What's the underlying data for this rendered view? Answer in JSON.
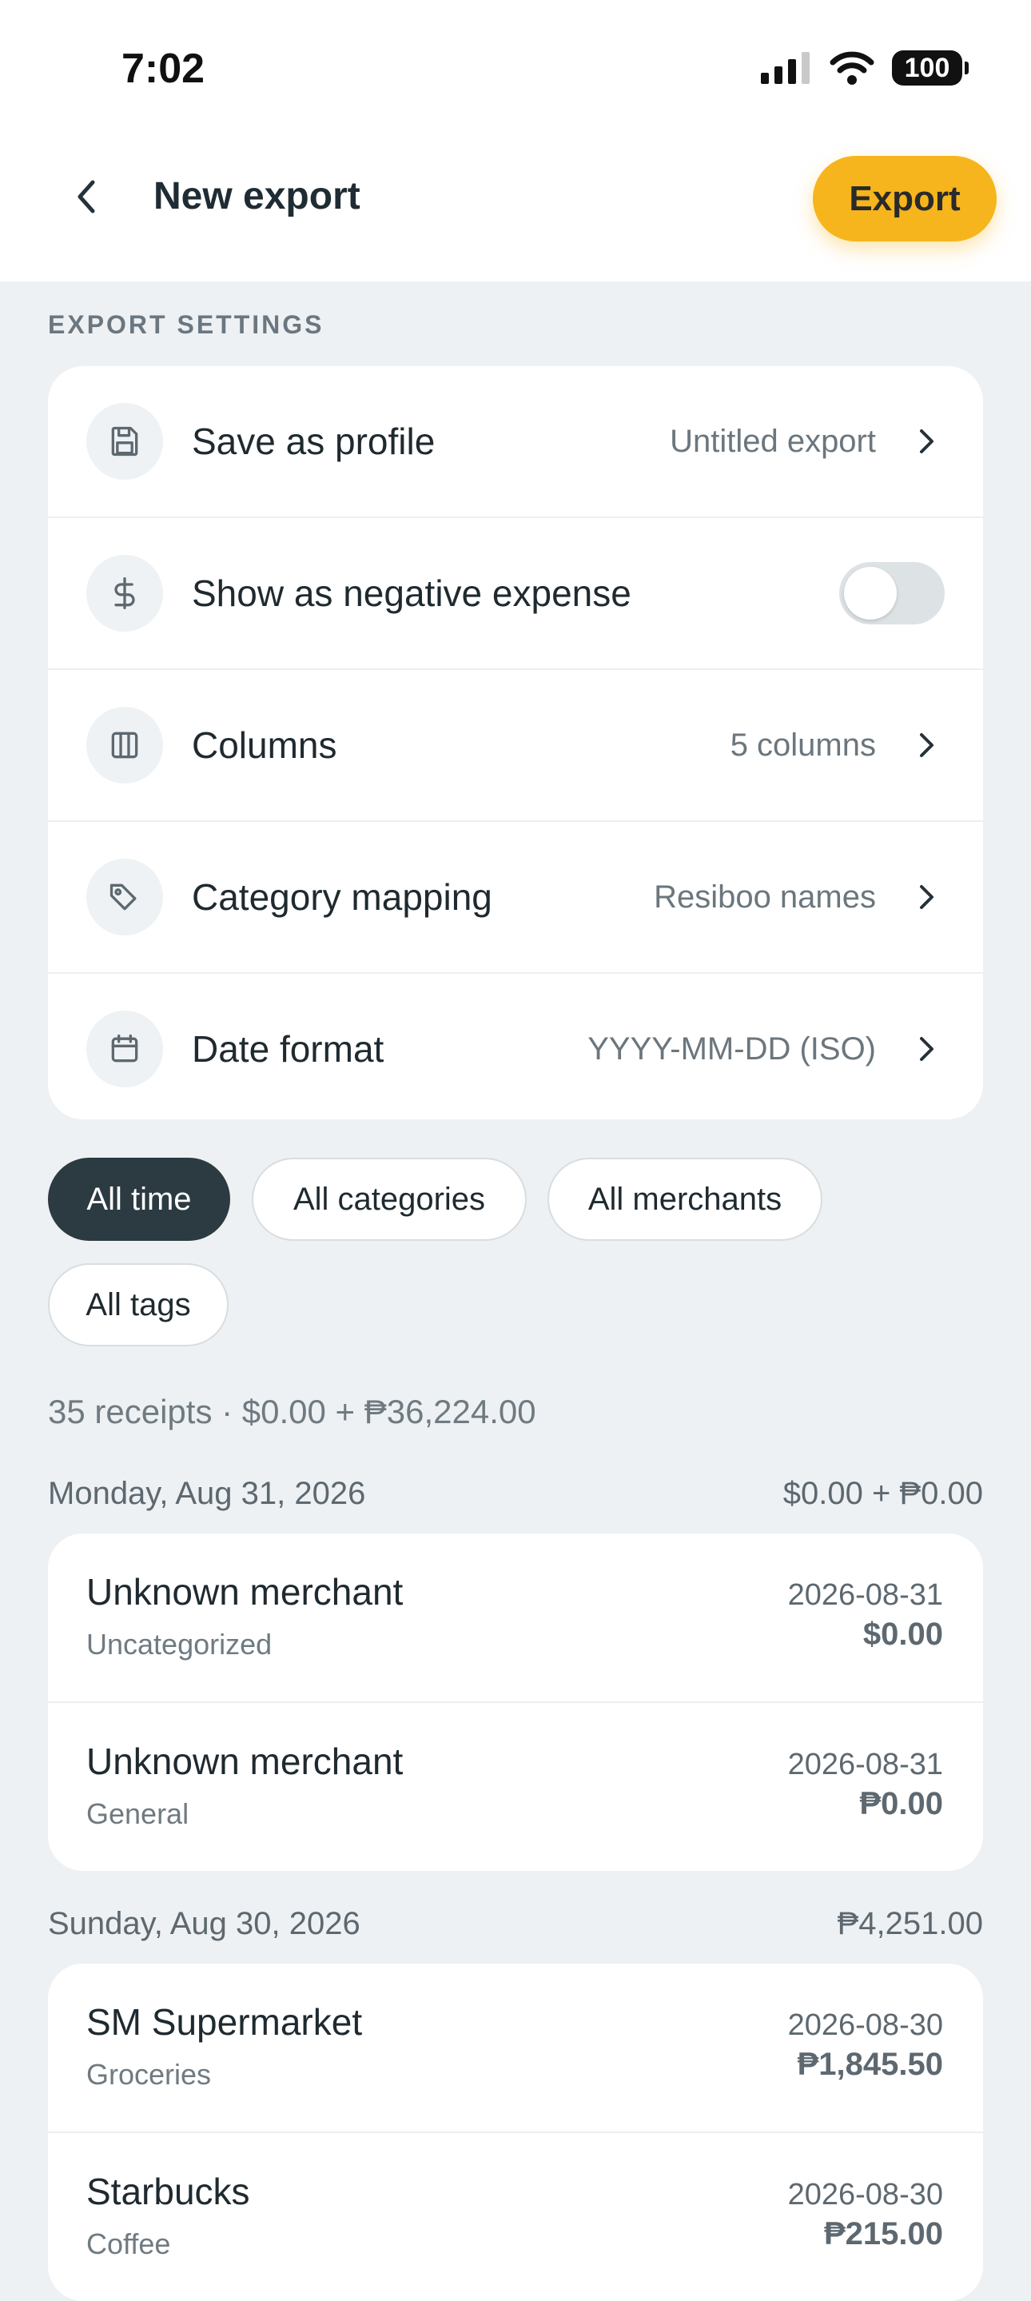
{
  "status_bar": {
    "time": "7:02",
    "battery": "100"
  },
  "header": {
    "title": "New export",
    "export_label": "Export"
  },
  "export_settings": {
    "section_label": "EXPORT SETTINGS",
    "rows": [
      {
        "label": "Save as profile",
        "value": "Untitled export",
        "icon": "save-icon"
      },
      {
        "label": "Show as negative expense",
        "toggle_on": false,
        "icon": "dollar-icon"
      },
      {
        "label": "Columns",
        "value": "5 columns",
        "icon": "columns-icon"
      },
      {
        "label": "Category mapping",
        "value": "Resiboo names",
        "icon": "tag-icon"
      },
      {
        "label": "Date format",
        "value": "YYYY-MM-DD (ISO)",
        "icon": "calendar-icon"
      }
    ]
  },
  "filters": [
    {
      "label": "All time",
      "active": true
    },
    {
      "label": "All categories",
      "active": false
    },
    {
      "label": "All merchants",
      "active": false
    },
    {
      "label": "All tags",
      "active": false
    }
  ],
  "summary": "35 receipts · $0.00 + ₱36,224.00",
  "groups": [
    {
      "date": "Monday, Aug 31, 2026",
      "total": "$0.00 + ₱0.00",
      "receipts": [
        {
          "merchant": "Unknown merchant",
          "category": "Uncategorized",
          "date": "2026-08-31",
          "amount": "$0.00"
        },
        {
          "merchant": "Unknown merchant",
          "category": "General",
          "date": "2026-08-31",
          "amount": "₱0.00"
        }
      ]
    },
    {
      "date": "Sunday, Aug 30, 2026",
      "total": "₱4,251.00",
      "receipts": [
        {
          "merchant": "SM Supermarket",
          "category": "Groceries",
          "date": "2026-08-30",
          "amount": "₱1,845.50"
        },
        {
          "merchant": "Starbucks",
          "category": "Coffee",
          "date": "2026-08-30",
          "amount": "₱215.00"
        }
      ]
    }
  ],
  "colors": {
    "accent": "#f6b51c",
    "active_chip": "#2c3a42",
    "background": "#eef1f3"
  }
}
